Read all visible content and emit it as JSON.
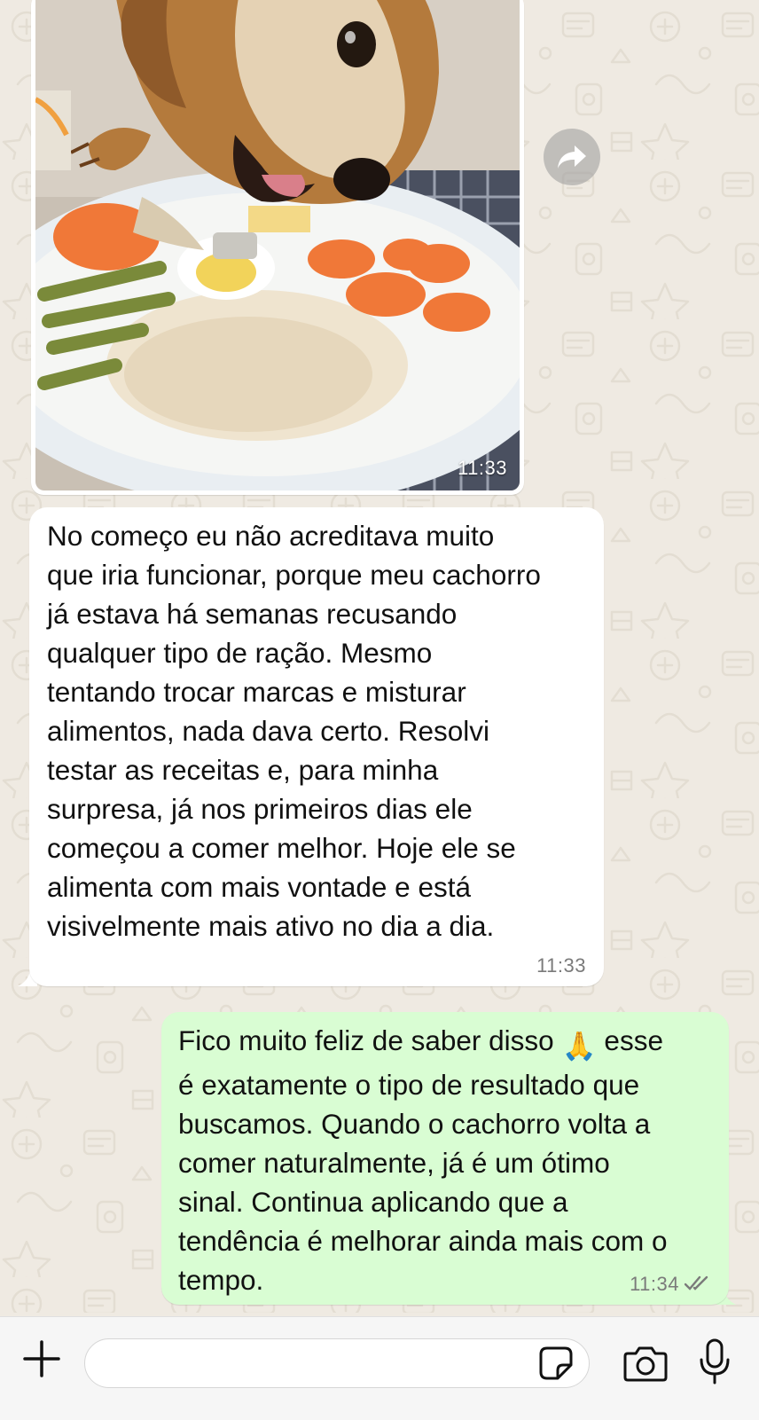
{
  "chat": {
    "messages": [
      {
        "type": "image",
        "direction": "incoming",
        "time": "11:33"
      },
      {
        "type": "text",
        "direction": "incoming",
        "text": "No começo eu não acreditava muito\nque iria funcionar, porque meu cachorro\njá estava há semanas recusando\nqualquer tipo de ração. Mesmo\ntentando trocar marcas e misturar\nalimentos, nada dava certo. Resolvi\ntestar as receitas e, para minha\nsurpresa, já nos primeiros dias ele\ncomeçou a comer melhor. Hoje ele se\nalimenta com mais vontade e está\nvisivelmente mais ativo no dia a dia.",
        "time": "11:33"
      },
      {
        "type": "text",
        "direction": "outgoing",
        "text_before_emoji": "Fico muito feliz de saber disso ",
        "emoji": "🙏",
        "text_after_emoji": " esse\né exatamente o tipo de resultado que\nbuscamos. Quando o cachorro volta a\ncomer naturalmente, já é um ótimo\nsinal. Continua aplicando que a\ntendência é melhorar ainda mais com o\ntempo.",
        "time": "11:34",
        "status": "read"
      }
    ]
  },
  "icons": {
    "forward": "forward-icon",
    "plus": "plus-icon",
    "sticker": "sticker-icon",
    "camera": "camera-icon",
    "mic": "microphone-icon",
    "ticks": "double-check-icon"
  },
  "composer": {
    "value": "",
    "placeholder": ""
  },
  "colors": {
    "background": "#efeae2",
    "incoming_bubble": "#ffffff",
    "outgoing_bubble": "#d9fdd3",
    "time_text": "#7a7a7a"
  }
}
